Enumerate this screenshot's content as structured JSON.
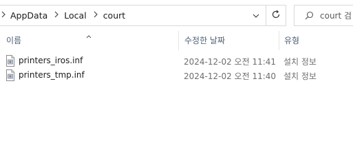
{
  "address_bar": {
    "breadcrumbs": [
      "AppData",
      "Local",
      "court"
    ],
    "separator_icon": "chevron-right-icon",
    "dropdown_icon": "chevron-down-icon"
  },
  "refresh_icon": "refresh-icon",
  "search": {
    "placeholder": "court 검",
    "icon": "search-icon"
  },
  "columns": {
    "name": "이름",
    "date_modified": "수정한 날짜",
    "type": "유형",
    "sort_indicator": "^"
  },
  "files": [
    {
      "name": "printers_iros.inf",
      "date_modified": "2024-12-02 오전 11:41",
      "type": "설치 정보",
      "icon": "inf-file-icon"
    },
    {
      "name": "printers_tmp.inf",
      "date_modified": "2024-12-02 오전 11:40",
      "type": "설치 정보",
      "icon": "inf-file-icon"
    }
  ],
  "colors": {
    "header_text": "#4c607a",
    "secondary_text": "#6d6d6d",
    "border": "#d9d9d9"
  }
}
